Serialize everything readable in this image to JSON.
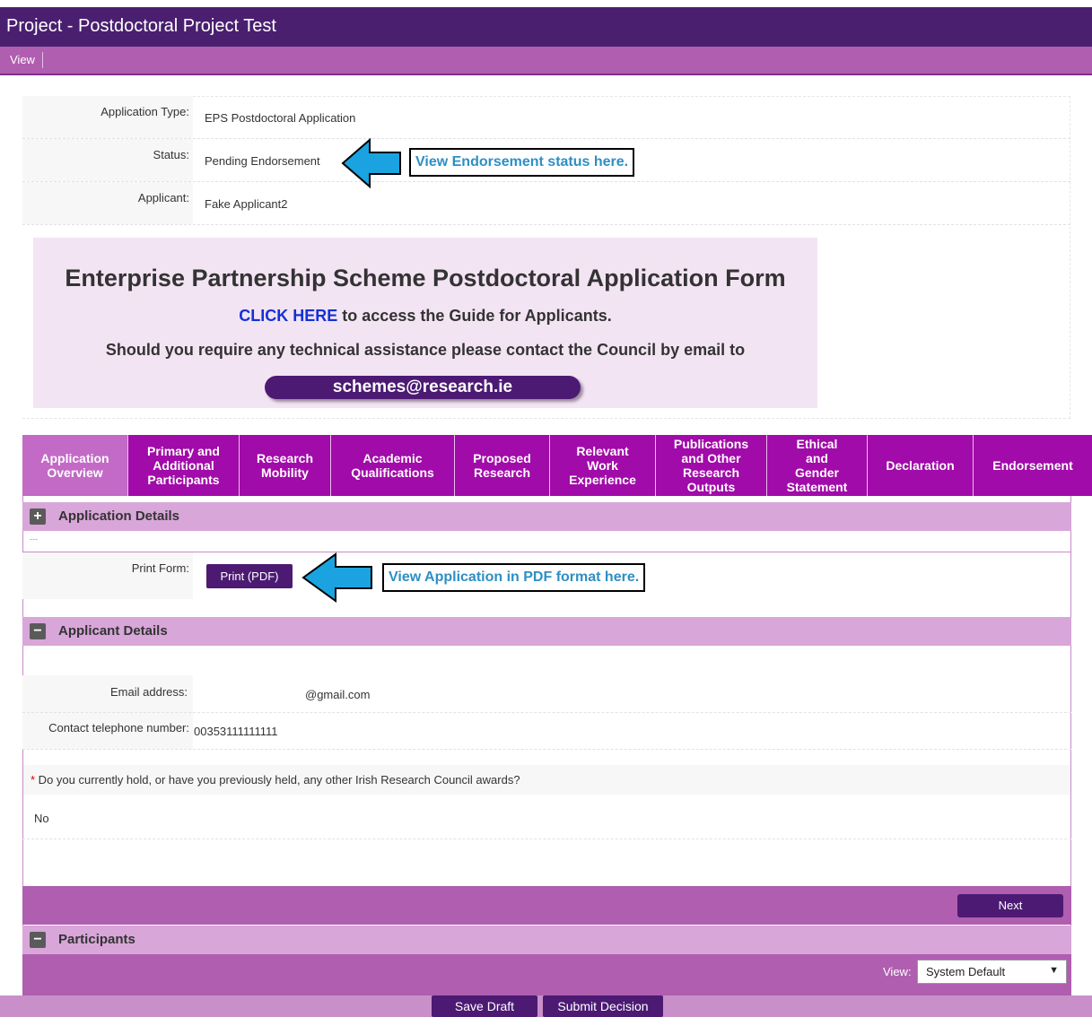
{
  "window": {
    "title": "Project - Postdoctoral Project Test"
  },
  "menu": {
    "view_label": "View"
  },
  "summary": {
    "application_type_label": "Application Type:",
    "application_type_value": "EPS Postdoctoral Application",
    "status_label": "Status:",
    "status_value": "Pending Endorsement",
    "applicant_label": "Applicant:",
    "applicant_value": "Fake Applicant2"
  },
  "callouts": {
    "status": "View Endorsement status here.",
    "pdf": "View Application in PDF format here."
  },
  "banner": {
    "title": "Enterprise Partnership Scheme Postdoctoral Application Form",
    "guide_link": "CLICK HERE",
    "guide_text": " to access the Guide for Applicants.",
    "support_text": "Should you require any technical assistance please contact the Council by email to",
    "email": "schemes@research.ie"
  },
  "tabs": [
    {
      "line1": "Application",
      "line2": "Overview"
    },
    {
      "line1": "Primary and",
      "line2": "Additional",
      "line3": "Participants"
    },
    {
      "line1": "Research",
      "line2": "Mobility"
    },
    {
      "line1": "Academic",
      "line2": "Qualifications"
    },
    {
      "line1": "Proposed",
      "line2": "Research"
    },
    {
      "line1": "Relevant",
      "line2": "Work",
      "line3": "Experience"
    },
    {
      "line1": "Publications",
      "line2": "and Other",
      "line3": "Research",
      "line4": "Outputs"
    },
    {
      "line1": "Ethical",
      "line2": "and",
      "line3": "Gender",
      "line4": "Statement"
    },
    {
      "line1": "Declaration"
    },
    {
      "line1": "Endorsement"
    }
  ],
  "sections": {
    "application_details": {
      "title": "Application Details",
      "toggle": "+",
      "dots": "---"
    },
    "applicant_details": {
      "title": "Applicant Details",
      "toggle": "−"
    },
    "participants": {
      "title": "Participants",
      "toggle": "−"
    }
  },
  "print_form": {
    "label": "Print Form:",
    "button": "Print (PDF)"
  },
  "applicant": {
    "email_label": "Email address:",
    "email_value": "@gmail.com",
    "phone_label": "Contact telephone number:",
    "phone_value": "00353111111111",
    "question_star": "*",
    "question": " Do you currently hold, or have you previously held, any other Irish Research Council awards?",
    "answer": "No"
  },
  "footer": {
    "next_button": "Next",
    "view_label": "View:",
    "view_select": "System Default",
    "save_draft": "Save Draft",
    "submit_decision": "Submit Decision"
  },
  "colors": {
    "accent": "#a10ba9",
    "dark_purple": "#4c1a73",
    "callout_blue": "#2d8fc4",
    "arrow_blue": "#1aa3e0"
  }
}
